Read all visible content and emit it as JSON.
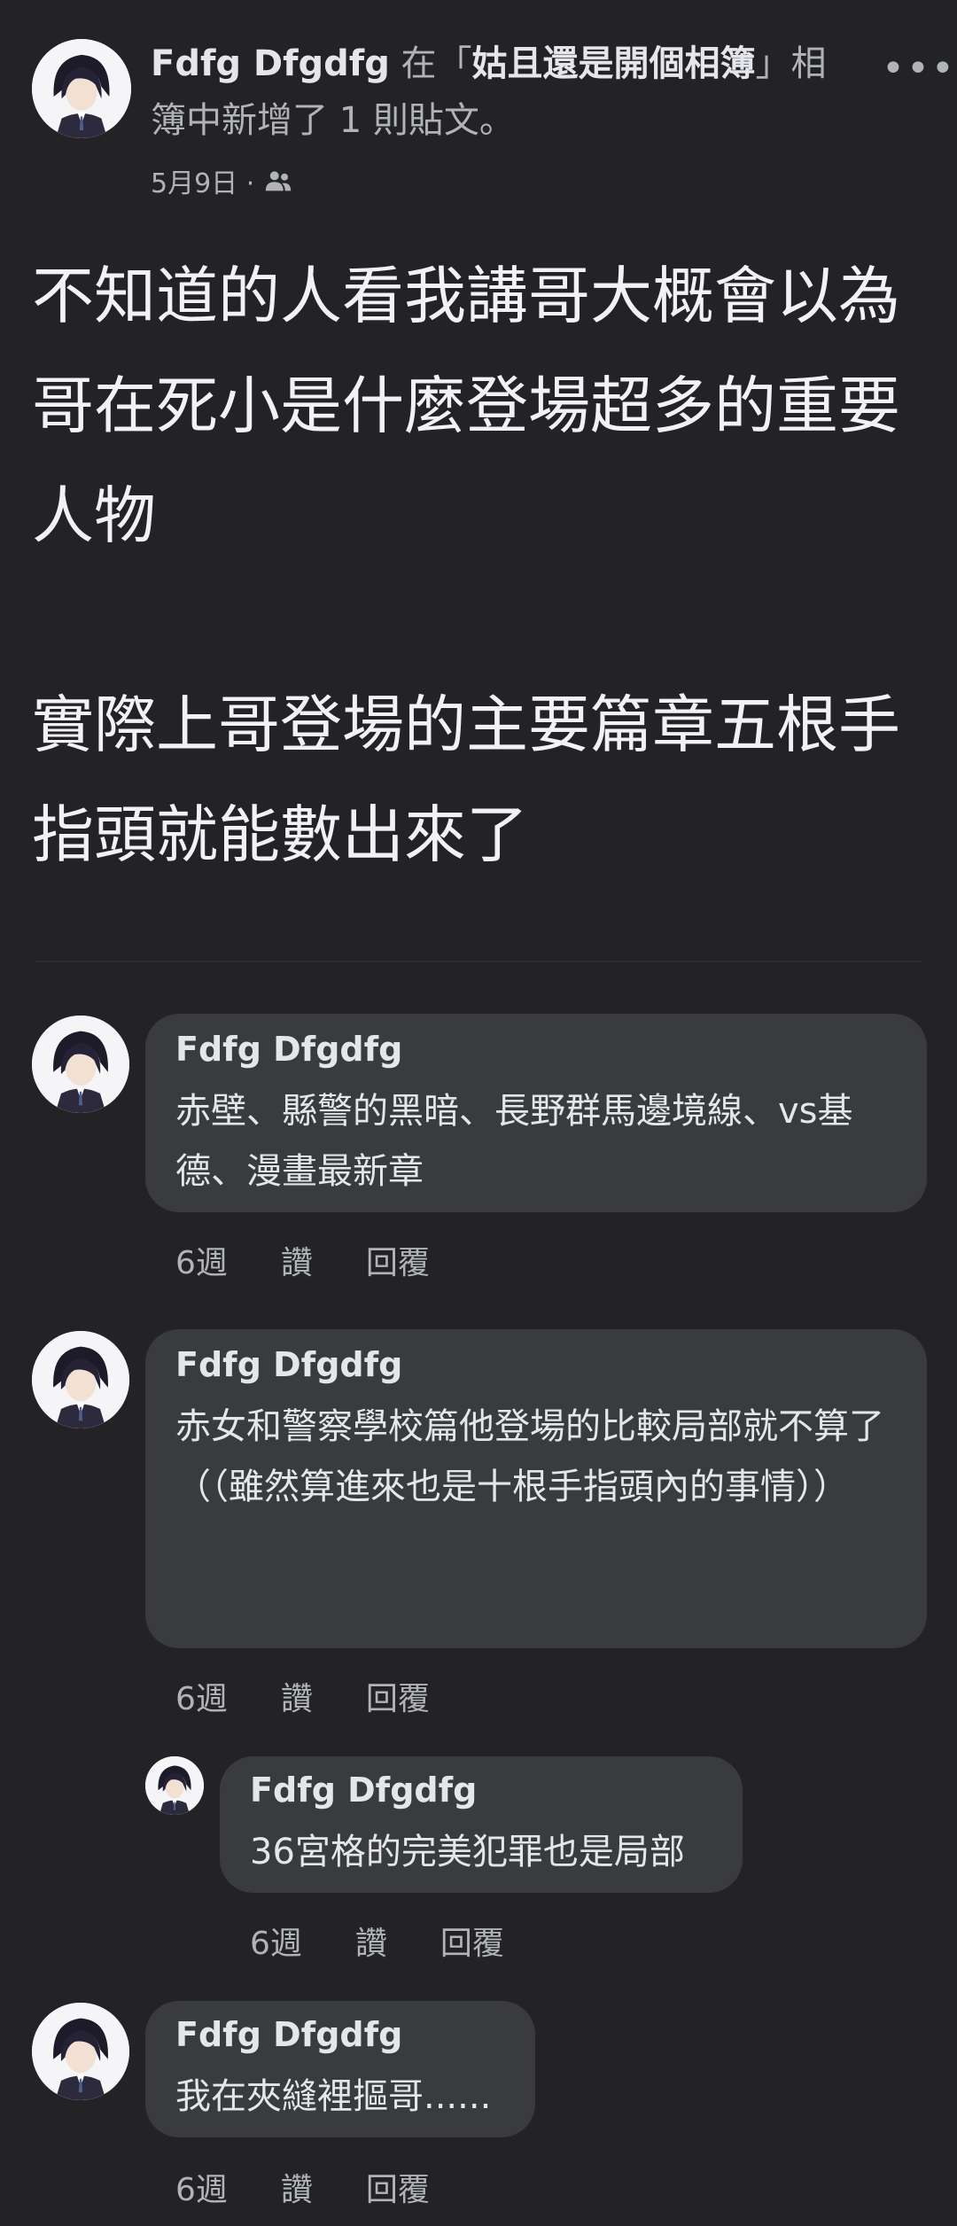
{
  "post": {
    "author": "Fdfg Dfgdfg",
    "in_text": "在「",
    "album": "姑且還是開個相簿",
    "suffix": "」相簿中新增了 1 則貼文。",
    "date": "5月9日 ·",
    "audience_icon": "friends-icon",
    "more_icon": "more-dots-icon",
    "paragraph_1": "不知道的人看我講哥大概會以為哥在死小是什麼登場超多的重要人物",
    "paragraph_2": "實際上哥登場的主要篇章五根手指頭就能數出來了"
  },
  "comments": [
    {
      "name": "Fdfg Dfgdfg",
      "text": "赤壁、縣警的黑暗、長野群馬邊境線、vs基德、漫畫最新章",
      "time": "6週",
      "like": "讚",
      "reply": "回覆"
    },
    {
      "name": "Fdfg Dfgdfg",
      "text": "赤女和警察學校篇他登場的比較局部就不算了\n（（雖然算進來也是十根手指頭內的事情））",
      "time": "6週",
      "like": "讚",
      "reply": "回覆"
    },
    {
      "name": "Fdfg Dfgdfg",
      "text": "36宮格的完美犯罪也是局部",
      "time": "6週",
      "like": "讚",
      "reply": "回覆"
    },
    {
      "name": "Fdfg Dfgdfg",
      "text": "我在夾縫裡摳哥......",
      "time": "6週",
      "like": "讚",
      "reply": "回覆"
    }
  ],
  "colors": {
    "background": "#232326",
    "bubble": "#3a3b3c",
    "muted": "#b0b3b8"
  }
}
